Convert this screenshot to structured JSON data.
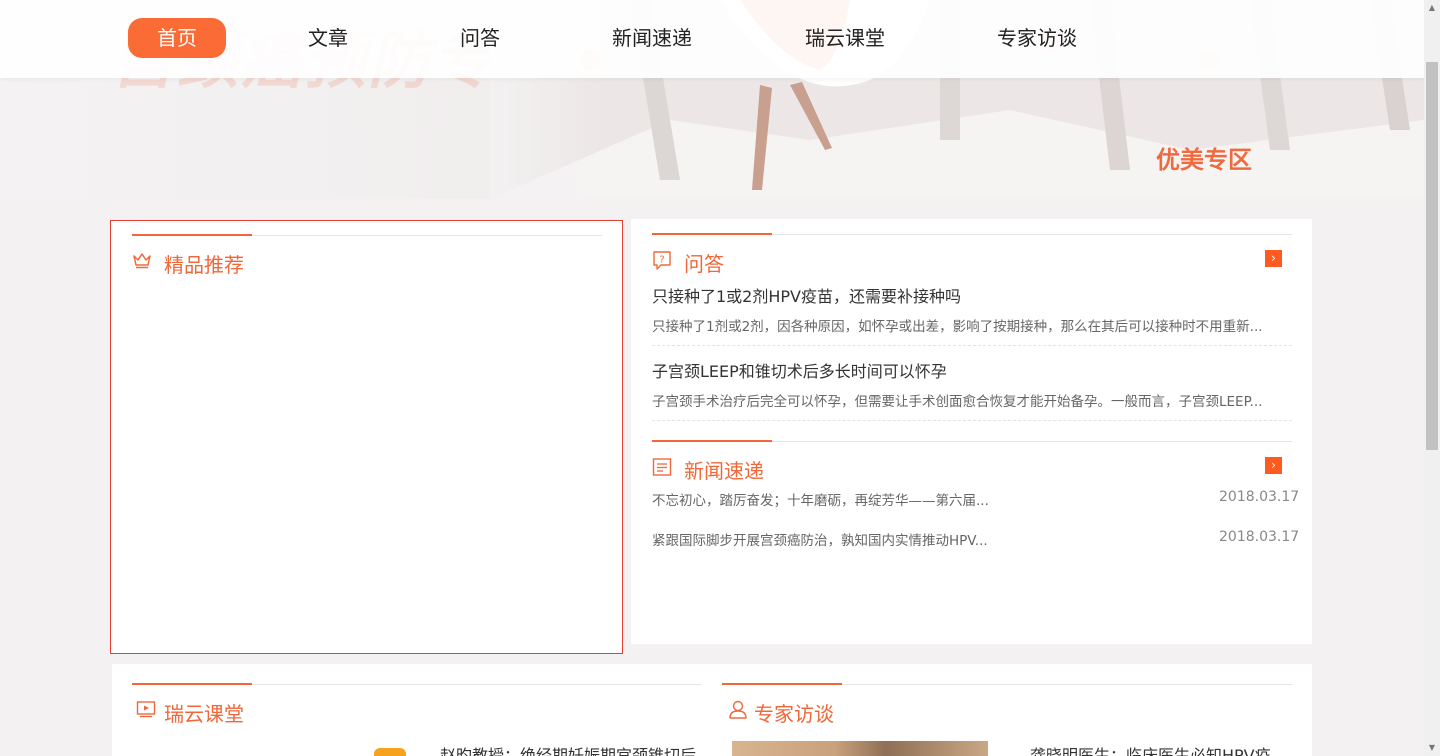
{
  "hero": {
    "bg_text": "宫颈癌预防专区",
    "tag": "优美专区"
  },
  "nav": {
    "items": [
      {
        "label": "首页",
        "active": true
      },
      {
        "label": "文章",
        "active": false
      },
      {
        "label": "问答",
        "active": false
      },
      {
        "label": "新闻速递",
        "active": false
      },
      {
        "label": "瑞云课堂",
        "active": false
      },
      {
        "label": "专家访谈",
        "active": false
      }
    ]
  },
  "featured": {
    "title": "精品推荐",
    "icon": "crown-icon"
  },
  "qa": {
    "title": "问答",
    "icon": "question-bubble-icon",
    "more": "›",
    "items": [
      {
        "title": "只接种了1或2剂HPV疫苗，还需要补接种吗",
        "desc": "只接种了1剂或2剂，因各种原因，如怀孕或出差，影响了按期接种，那么在其后可以接种时不用重新..."
      },
      {
        "title": "子宫颈LEEP和锥切术后多长时间可以怀孕",
        "desc": "子宫颈手术治疗后完全可以怀孕，但需要让手术创面愈合恢复才能开始备孕。一般而言，子宫颈LEEP..."
      }
    ]
  },
  "news": {
    "title": "新闻速递",
    "icon": "news-list-icon",
    "more": "›",
    "items": [
      {
        "text": "不忘初心，踏厉奋发；十年磨砺，再绽芳华——第六届...",
        "date": "2018.03.17"
      },
      {
        "text": "紧跟国际脚步开展宫颈癌防治，孰知国内实情推动HPV...",
        "date": "2018.03.17"
      }
    ]
  },
  "classroom": {
    "title": "瑞云课堂",
    "icon": "video-play-icon",
    "card_title": "赵昀教授：绝经期妊娠期宫颈锥切后"
  },
  "interview": {
    "title": "专家访谈",
    "icon": "expert-person-icon",
    "card_title": "龚晓明医生：临床医生必知HPV疫"
  },
  "colors": {
    "accent": "#f0683a",
    "nav_active": "#fa6b36",
    "featured_border": "#e54033"
  }
}
